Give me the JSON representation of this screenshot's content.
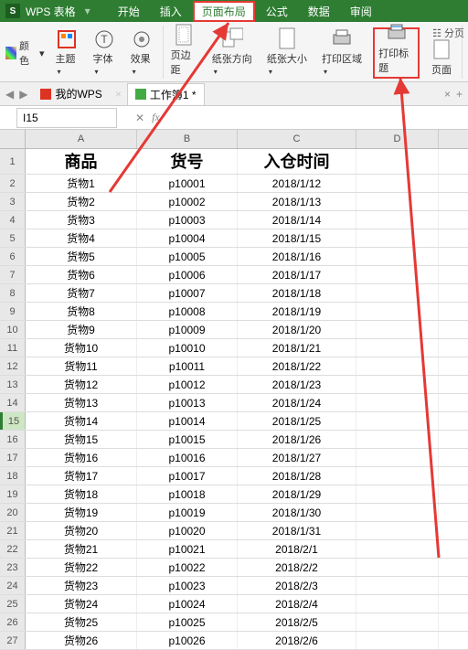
{
  "titlebar": {
    "app": "WPS 表格",
    "sep": "▾"
  },
  "tabs": {
    "t0": "开始",
    "t1": "插入",
    "t2": "页面布局",
    "t3": "公式",
    "t4": "数据",
    "t5": "审阅"
  },
  "ribbon": {
    "theme": "主题",
    "font": "字体",
    "effect": "效果",
    "color": "颜色",
    "margin": "页边距",
    "orient": "纸张方向",
    "size": "纸张大小",
    "printarea": "打印区域",
    "printtitle": "打印标题",
    "pagesetup": "页面",
    "split": "分页"
  },
  "docs": {
    "mywps": "我的WPS",
    "book": "工作簿1 *"
  },
  "namebox": {
    "ref": "I15",
    "fx": "fx"
  },
  "colhdr": {
    "A": "A",
    "B": "B",
    "C": "C",
    "D": "D"
  },
  "header": {
    "A": "商品",
    "B": "货号",
    "C": "入仓时间"
  },
  "rows": [
    {
      "n": "1"
    },
    {
      "n": "2",
      "A": "货物1",
      "B": "p10001",
      "C": "2018/1/12"
    },
    {
      "n": "3",
      "A": "货物2",
      "B": "p10002",
      "C": "2018/1/13"
    },
    {
      "n": "4",
      "A": "货物3",
      "B": "p10003",
      "C": "2018/1/14"
    },
    {
      "n": "5",
      "A": "货物4",
      "B": "p10004",
      "C": "2018/1/15"
    },
    {
      "n": "6",
      "A": "货物5",
      "B": "p10005",
      "C": "2018/1/16"
    },
    {
      "n": "7",
      "A": "货物6",
      "B": "p10006",
      "C": "2018/1/17"
    },
    {
      "n": "8",
      "A": "货物7",
      "B": "p10007",
      "C": "2018/1/18"
    },
    {
      "n": "9",
      "A": "货物8",
      "B": "p10008",
      "C": "2018/1/19"
    },
    {
      "n": "10",
      "A": "货物9",
      "B": "p10009",
      "C": "2018/1/20"
    },
    {
      "n": "11",
      "A": "货物10",
      "B": "p10010",
      "C": "2018/1/21"
    },
    {
      "n": "12",
      "A": "货物11",
      "B": "p10011",
      "C": "2018/1/22"
    },
    {
      "n": "13",
      "A": "货物12",
      "B": "p10012",
      "C": "2018/1/23"
    },
    {
      "n": "14",
      "A": "货物13",
      "B": "p10013",
      "C": "2018/1/24"
    },
    {
      "n": "15",
      "A": "货物14",
      "B": "p10014",
      "C": "2018/1/25"
    },
    {
      "n": "16",
      "A": "货物15",
      "B": "p10015",
      "C": "2018/1/26"
    },
    {
      "n": "17",
      "A": "货物16",
      "B": "p10016",
      "C": "2018/1/27"
    },
    {
      "n": "18",
      "A": "货物17",
      "B": "p10017",
      "C": "2018/1/28"
    },
    {
      "n": "19",
      "A": "货物18",
      "B": "p10018",
      "C": "2018/1/29"
    },
    {
      "n": "20",
      "A": "货物19",
      "B": "p10019",
      "C": "2018/1/30"
    },
    {
      "n": "21",
      "A": "货物20",
      "B": "p10020",
      "C": "2018/1/31"
    },
    {
      "n": "22",
      "A": "货物21",
      "B": "p10021",
      "C": "2018/2/1"
    },
    {
      "n": "23",
      "A": "货物22",
      "B": "p10022",
      "C": "2018/2/2"
    },
    {
      "n": "24",
      "A": "货物23",
      "B": "p10023",
      "C": "2018/2/3"
    },
    {
      "n": "25",
      "A": "货物24",
      "B": "p10024",
      "C": "2018/2/4"
    },
    {
      "n": "26",
      "A": "货物25",
      "B": "p10025",
      "C": "2018/2/5"
    },
    {
      "n": "27",
      "A": "货物26",
      "B": "p10026",
      "C": "2018/2/6"
    }
  ]
}
